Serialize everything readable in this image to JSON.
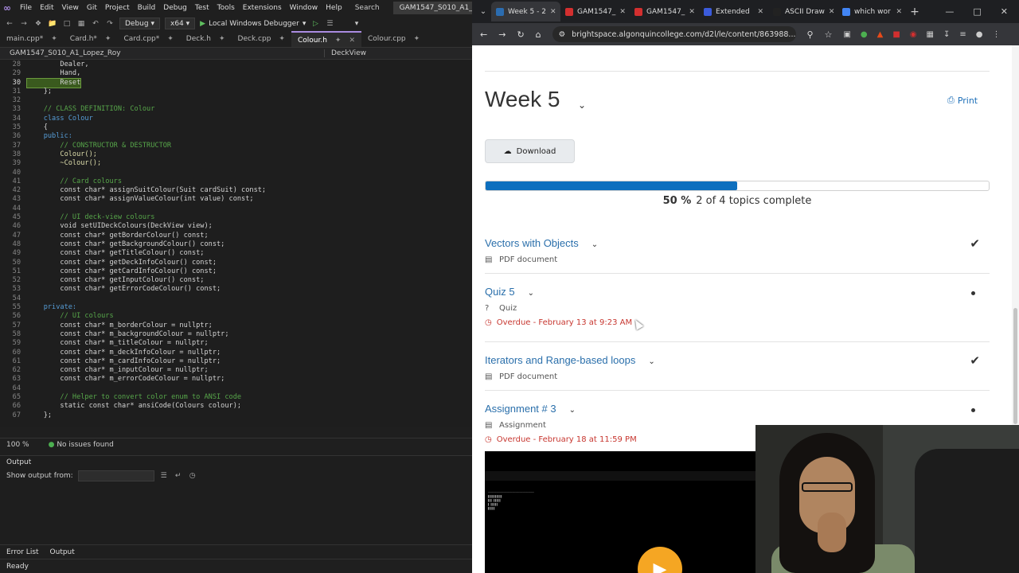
{
  "vs": {
    "logo": "∞",
    "menu": [
      "File",
      "Edit",
      "View",
      "Git",
      "Project",
      "Build",
      "Debug",
      "Test",
      "Tools",
      "Extensions",
      "Window",
      "Help"
    ],
    "search": "Search",
    "solution": "GAM1547_S010_A1_Lopez_Roy",
    "config": "Debug",
    "platform": "x64",
    "run": "Local Windows Debugger",
    "tabs": [
      {
        "label": "main.cpp*"
      },
      {
        "label": "Card.h*"
      },
      {
        "label": "Card.cpp*"
      },
      {
        "label": "Deck.h"
      },
      {
        "label": "Deck.cpp"
      },
      {
        "label": "Colour.h",
        "active": true
      },
      {
        "label": "Colour.cpp"
      }
    ],
    "nav_left": "GAM1547_S010_A1_Lopez_Roy",
    "nav_right": "DeckView",
    "zoom": "100 %",
    "issues": "No issues found",
    "output_title": "Output",
    "show_output": "Show output from:",
    "bottom_tabs": [
      "Error List",
      "Output"
    ],
    "status": "Ready"
  },
  "code": [
    {
      "n": "28",
      "t": "        Dealer,"
    },
    {
      "n": "29",
      "t": "        Hand,"
    },
    {
      "n": "30",
      "t": "        Reset",
      "hl": true
    },
    {
      "n": "31",
      "t": "    };"
    },
    {
      "n": "32",
      "t": ""
    },
    {
      "n": "33",
      "t": "    // CLASS DEFINITION: Colour",
      "c": "cm"
    },
    {
      "n": "34",
      "t": "    class Colour",
      "c": "k"
    },
    {
      "n": "35",
      "t": "    {"
    },
    {
      "n": "36",
      "t": "    public:",
      "c": "k"
    },
    {
      "n": "37",
      "t": "        // CONSTRUCTOR & DESTRUCTOR",
      "c": "cm"
    },
    {
      "n": "38",
      "t": "        Colour();",
      "c": "f"
    },
    {
      "n": "39",
      "t": "        ~Colour();",
      "c": "f"
    },
    {
      "n": "40",
      "t": ""
    },
    {
      "n": "41",
      "t": "        // Card colours",
      "c": "cm"
    },
    {
      "n": "42",
      "t": "        const char* assignSuitColour(Suit cardSuit) const;"
    },
    {
      "n": "43",
      "t": "        const char* assignValueColour(int value) const;"
    },
    {
      "n": "44",
      "t": ""
    },
    {
      "n": "45",
      "t": "        // UI deck-view colours",
      "c": "cm"
    },
    {
      "n": "46",
      "t": "        void setUIDeckColours(DeckView view);"
    },
    {
      "n": "47",
      "t": "        const char* getBorderColour() const;"
    },
    {
      "n": "48",
      "t": "        const char* getBackgroundColour() const;"
    },
    {
      "n": "49",
      "t": "        const char* getTitleColour() const;"
    },
    {
      "n": "50",
      "t": "        const char* getDeckInfoColour() const;"
    },
    {
      "n": "51",
      "t": "        const char* getCardInfoColour() const;"
    },
    {
      "n": "52",
      "t": "        const char* getInputColour() const;"
    },
    {
      "n": "53",
      "t": "        const char* getErrorCodeColour() const;"
    },
    {
      "n": "54",
      "t": ""
    },
    {
      "n": "55",
      "t": "    private:",
      "c": "k"
    },
    {
      "n": "56",
      "t": "        // UI colours",
      "c": "cm"
    },
    {
      "n": "57",
      "t": "        const char* m_borderColour = nullptr;"
    },
    {
      "n": "58",
      "t": "        const char* m_backgroundColour = nullptr;"
    },
    {
      "n": "59",
      "t": "        const char* m_titleColour = nullptr;"
    },
    {
      "n": "60",
      "t": "        const char* m_deckInfoColour = nullptr;"
    },
    {
      "n": "61",
      "t": "        const char* m_cardInfoColour = nullptr;"
    },
    {
      "n": "62",
      "t": "        const char* m_inputColour = nullptr;"
    },
    {
      "n": "63",
      "t": "        const char* m_errorCodeColour = nullptr;"
    },
    {
      "n": "64",
      "t": ""
    },
    {
      "n": "65",
      "t": "        // Helper to convert color enum to ANSI code",
      "c": "cm"
    },
    {
      "n": "66",
      "t": "        static const char* ansiCode(Colours colour);"
    },
    {
      "n": "67",
      "t": "    };"
    }
  ],
  "browser": {
    "tabs": [
      {
        "label": "Week 5 - 2",
        "icon": "#2b6cb0",
        "active": true
      },
      {
        "label": "GAM1547_",
        "icon": "#d32f2f"
      },
      {
        "label": "GAM1547_",
        "icon": "#d32f2f"
      },
      {
        "label": "Extended",
        "icon": "#3b5bdb"
      },
      {
        "label": "ASCII Draw",
        "icon": "#222"
      },
      {
        "label": "which wor",
        "icon": "#4285f4"
      }
    ],
    "url": "brightspace.algonquincollege.com/d2l/le/content/863988..."
  },
  "page": {
    "title": "Week 5",
    "print": "Print",
    "download": "Download",
    "progress": {
      "percent": 50,
      "percent_label": "50 %",
      "text": "2 of 4 topics complete"
    },
    "topics": [
      {
        "title": "Vectors with Objects",
        "type": "PDF document",
        "status": "complete"
      },
      {
        "title": "Quiz 5",
        "type": "Quiz",
        "status": "incomplete",
        "overdue": "Overdue - February 13 at 9:23 AM"
      },
      {
        "title": "Iterators and Range-based loops",
        "type": "PDF document",
        "status": "complete"
      },
      {
        "title": "Assignment # 3",
        "type": "Assignment",
        "status": "incomplete",
        "overdue": "Overdue - February 18 at 11:59 PM"
      }
    ]
  },
  "colors": {
    "accent": "#0e6fbe",
    "link": "#2a6fab",
    "overdue": "#c7362f",
    "vs_accent": "#a98be0"
  }
}
